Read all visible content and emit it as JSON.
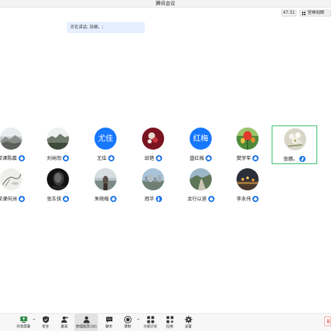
{
  "window": {
    "title": "腾讯会议"
  },
  "topbar": {
    "timer": "47:31",
    "view_label": "宫格视图"
  },
  "speaking": {
    "text": "正在讲话: 张娜。;"
  },
  "participants": [
    {
      "name": "家课陈晨",
      "avatar": "landscape-photo",
      "status": "mic"
    },
    {
      "name": "刘尚阳",
      "avatar": "landscape-photo",
      "status": "mic"
    },
    {
      "name": "尤佳",
      "avatar_text": "尤佳",
      "status": "mic"
    },
    {
      "name": "邱艳",
      "avatar": "flower-photo",
      "status": "mic"
    },
    {
      "name": "盛红梅",
      "avatar_text": "红梅",
      "status": "mic"
    },
    {
      "name": "樊学军",
      "avatar": "tulip-photo",
      "status": "mic"
    },
    {
      "name": "张娜。",
      "avatar": "flowers-photo",
      "status": "download"
    },
    {
      "name": "家课何洲",
      "avatar": "ink-painting",
      "status": "mic"
    },
    {
      "name": "张东侠",
      "avatar": "dark-portrait",
      "status": "mic"
    },
    {
      "name": "朱晓梅",
      "avatar": "seaside-photo",
      "status": "mic"
    },
    {
      "name": "周华",
      "avatar": "city-photo",
      "status": "download"
    },
    {
      "name": "龙行以道",
      "avatar": "road-photo",
      "status": "mic"
    },
    {
      "name": "李永伟",
      "avatar": "night-photo",
      "status": "mic"
    }
  ],
  "toolbar": {
    "items": [
      {
        "label": "共享屏幕",
        "icon": "share-screen-icon"
      },
      {
        "label": "安全",
        "icon": "shield-icon"
      },
      {
        "label": "邀请",
        "icon": "invite-icon"
      },
      {
        "label": "管理成员(16)",
        "icon": "members-icon"
      },
      {
        "label": "聊天",
        "icon": "chat-icon"
      },
      {
        "label": "录制",
        "icon": "record-icon"
      },
      {
        "label": "分组讨论",
        "icon": "breakout-icon"
      },
      {
        "label": "应用",
        "icon": "apps-icon"
      },
      {
        "label": "设置",
        "icon": "settings-icon"
      }
    ]
  },
  "colors": {
    "accent": "#1677ff",
    "active_border": "#2eb85c",
    "speaking_bg": "#e6efff"
  }
}
